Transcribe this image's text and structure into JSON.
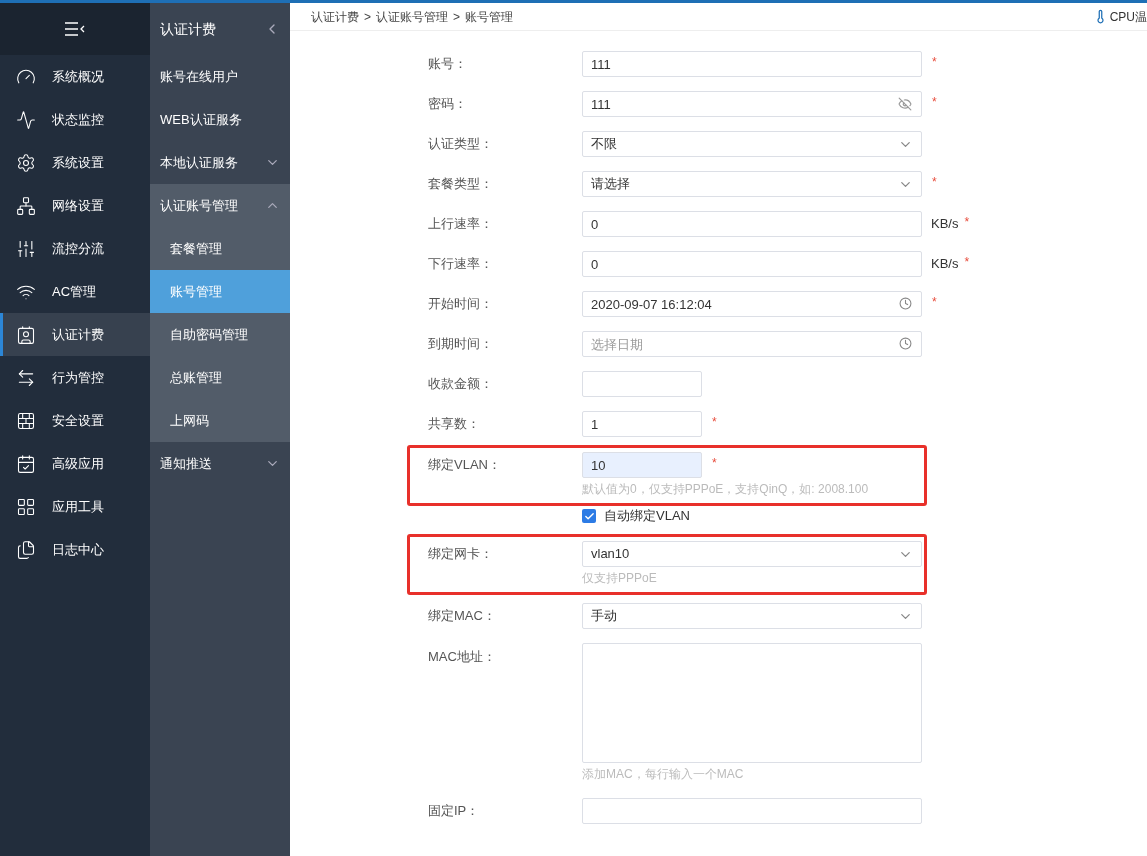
{
  "sidebar": {
    "items": [
      {
        "label": "系统概况",
        "selected": false
      },
      {
        "label": "状态监控",
        "selected": false
      },
      {
        "label": "系统设置",
        "selected": false
      },
      {
        "label": "网络设置",
        "selected": false
      },
      {
        "label": "流控分流",
        "selected": false
      },
      {
        "label": "AC管理",
        "selected": false
      },
      {
        "label": "认证计费",
        "selected": true
      },
      {
        "label": "行为管控",
        "selected": false
      },
      {
        "label": "安全设置",
        "selected": false
      },
      {
        "label": "高级应用",
        "selected": false
      },
      {
        "label": "应用工具",
        "selected": false
      },
      {
        "label": "日志中心",
        "selected": false
      }
    ]
  },
  "submenu": {
    "title": "认证计费",
    "items": [
      {
        "label": "账号在线用户"
      },
      {
        "label": "WEB认证服务"
      },
      {
        "label": "本地认证服务",
        "expanded": false
      },
      {
        "label": "认证账号管理",
        "expanded": true,
        "children": [
          {
            "label": "套餐管理",
            "selected": false
          },
          {
            "label": "账号管理",
            "selected": true
          },
          {
            "label": "自助密码管理",
            "selected": false
          },
          {
            "label": "总账管理",
            "selected": false
          },
          {
            "label": "上网码",
            "selected": false
          }
        ]
      },
      {
        "label": "通知推送",
        "expanded": false
      }
    ]
  },
  "breadcrumb": [
    "认证计费",
    "认证账号管理",
    "账号管理"
  ],
  "breadcrumb_separator": ">",
  "cpu_label": "CPU温",
  "form": [
    {
      "label": "账号：",
      "kind": "text",
      "value": "111",
      "required_mark": "*"
    },
    {
      "label": "密码：",
      "kind": "password",
      "value": "111",
      "required_mark": "*"
    },
    {
      "label": "认证类型：",
      "kind": "select",
      "value": "不限"
    },
    {
      "label": "套餐类型：",
      "kind": "select",
      "value": "请选择",
      "required_mark": "*"
    },
    {
      "label": "上行速率：",
      "kind": "text",
      "value": "0",
      "unit": "KB/s",
      "required_mark": "*"
    },
    {
      "label": "下行速率：",
      "kind": "text",
      "value": "0",
      "unit": "KB/s",
      "required_mark": "*"
    },
    {
      "label": "开始时间：",
      "kind": "date",
      "value": "2020-09-07 16:12:04",
      "required_mark": "*"
    },
    {
      "label": "到期时间：",
      "kind": "date",
      "placeholder": "选择日期"
    },
    {
      "label": "收款金额：",
      "kind": "short_text"
    },
    {
      "label": "共享数：",
      "kind": "short_text",
      "value": "1",
      "required_mark": "*"
    },
    {
      "label": "绑定VLAN：",
      "kind": "short_text",
      "value": "10",
      "required_mark": "*",
      "filled": true,
      "highlighted": true,
      "hint": "默认值为0，仅支持PPPoE，支持QinQ，如: 2008.100"
    },
    {
      "label": "自动绑定VLAN",
      "kind": "checkbox",
      "checked": true
    },
    {
      "label": "绑定网卡：",
      "kind": "select",
      "value": "vlan10",
      "highlighted": true,
      "hint": "仅支持PPPoE"
    },
    {
      "label": "绑定MAC：",
      "kind": "select",
      "value": "手动"
    },
    {
      "label": "MAC地址：",
      "kind": "textarea",
      "hint": "添加MAC，每行输入一个MAC"
    },
    {
      "label": "固定IP：",
      "kind": "text"
    }
  ]
}
